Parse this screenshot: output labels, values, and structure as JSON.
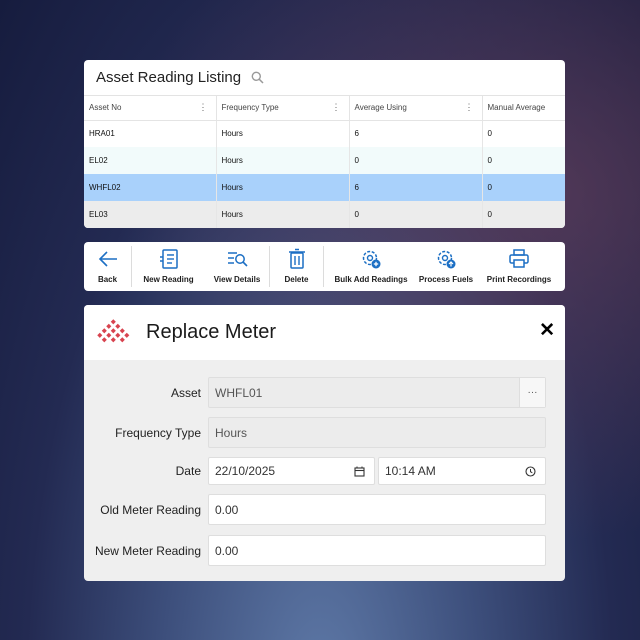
{
  "listing": {
    "title": "Asset Reading Listing",
    "columns": [
      "Asset No",
      "Frequency Type",
      "Average Using",
      "Manual Average"
    ],
    "rows": [
      [
        "HRA01",
        "Hours",
        "6",
        "0"
      ],
      [
        "EL02",
        "Hours",
        "0",
        "0"
      ],
      [
        "WHFL02",
        "Hours",
        "6",
        "0"
      ],
      [
        "EL03",
        "Hours",
        "0",
        "0"
      ]
    ],
    "selected_row": 2
  },
  "toolbar": {
    "back": "Back",
    "new_reading": "New Reading",
    "view_details": "View Details",
    "delete": "Delete",
    "bulk_add": "Bulk Add Readings",
    "process_fuels": "Process Fuels",
    "print_recordings": "Print Recordings"
  },
  "dialog": {
    "title": "Replace Meter",
    "asset_label": "Asset",
    "asset_value": "WHFL01",
    "asset_button": "···",
    "frequency_label": "Frequency Type",
    "frequency_value": "Hours",
    "date_label": "Date",
    "date_value": "22/10/2025",
    "time_value": "10:14 AM",
    "old_label": "Old Meter Reading",
    "old_value": "0.00",
    "new_label": "New Meter Reading",
    "new_value": "0.00"
  },
  "colors": {
    "accent_blue": "#1c6fc4",
    "selected_row": "#a9d1fb",
    "logo_red": "#d8434f"
  }
}
